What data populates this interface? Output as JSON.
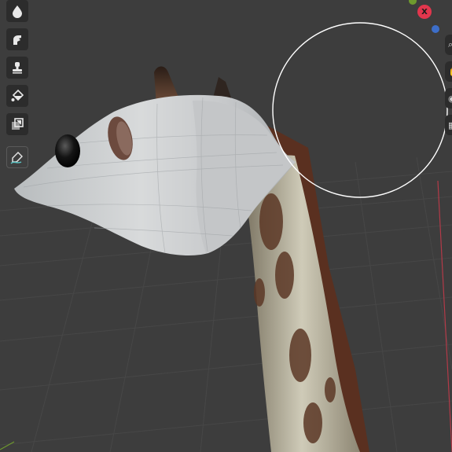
{
  "viewport": {
    "background": "#3d3d3d",
    "grid_color": "#4a4a4a",
    "axis_red": "#b33a48",
    "axis_green": "#6e9a2e"
  },
  "toolbar": {
    "tools": [
      {
        "id": "draw",
        "icon": "drop-icon"
      },
      {
        "id": "smear",
        "icon": "finger-icon"
      },
      {
        "id": "clone",
        "icon": "stamp-icon"
      },
      {
        "id": "fill",
        "icon": "paint-bucket-icon"
      },
      {
        "id": "mask",
        "icon": "mask-layers-icon"
      },
      {
        "id": "annotate",
        "icon": "pen-curve-icon"
      }
    ]
  },
  "gizmo": {
    "x_label": "X",
    "x_color": "#e2364d",
    "y_color": "#6e9a2e",
    "z_color": "#3d6ec9"
  },
  "brush_cursor": {
    "color": "#ffffff"
  }
}
